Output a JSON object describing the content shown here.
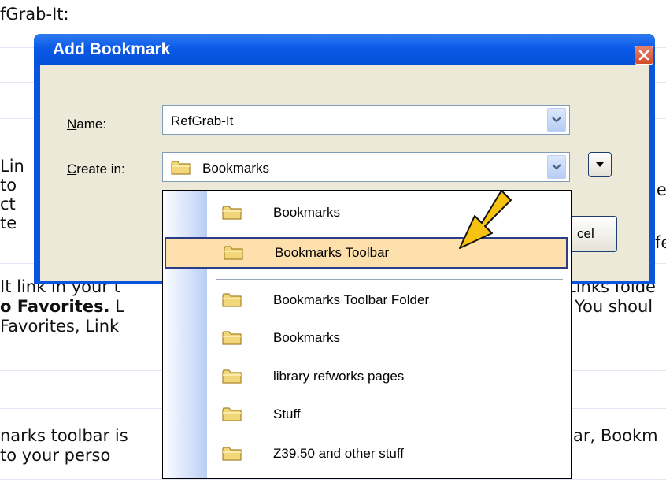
{
  "background": {
    "lines": [
      {
        "text": "fGrab-It:"
      },
      {
        "text": "Lin"
      },
      {
        "text": "to"
      },
      {
        "text": "ct"
      },
      {
        "text": "te"
      },
      {
        "text": "It link in your t"
      },
      {
        "bold": "o Favorites.",
        "text": "  L"
      },
      {
        "text": " Favorites, Link"
      },
      {
        "text": "narks toolbar is"
      },
      {
        "text": "to your perso"
      },
      {
        "text": "le"
      },
      {
        "text": "fe"
      },
      {
        "text": "Links folde"
      },
      {
        "text": "You shoul"
      },
      {
        "text": "ar, Bookm"
      }
    ]
  },
  "dialog": {
    "title": "Add Bookmark",
    "name_label_underlined": "N",
    "name_label_rest": "ame:",
    "name_value": "RefGrab-It",
    "create_label_underlined": "C",
    "create_label_rest": "reate in:",
    "create_value": "Bookmarks",
    "cancel_partial": "cel"
  },
  "dropdown": {
    "items": [
      {
        "label": "Bookmarks",
        "icon": "folder-icon"
      },
      {
        "label": "Bookmarks Toolbar",
        "icon": "folder-icon",
        "selected": true
      },
      {
        "label": "Bookmarks Toolbar Folder",
        "icon": "folder-icon"
      },
      {
        "label": "Bookmarks",
        "icon": "folder-icon"
      },
      {
        "label": "library refworks pages",
        "icon": "folder-icon"
      },
      {
        "label": "Stuff",
        "icon": "folder-icon"
      },
      {
        "label": "Z39.50 and other stuff",
        "icon": "folder-icon"
      }
    ]
  },
  "colors": {
    "title_bar": "#0a5ae8",
    "dialog_face": "#ece9d8",
    "selection": "#fde0ab",
    "annotation_arrow": "#f5c211"
  }
}
